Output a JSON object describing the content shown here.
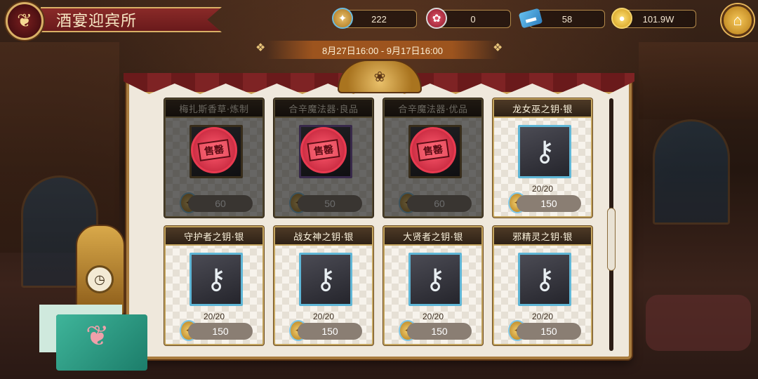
{
  "header": {
    "title": "酒宴迎宾所",
    "emblem_icon": "swirl-emblem-icon",
    "home_icon": "home-icon"
  },
  "currencies": [
    {
      "name": "medal",
      "icon": "medal-icon",
      "value": "222"
    },
    {
      "name": "rose",
      "icon": "rose-icon",
      "value": "0"
    },
    {
      "name": "ticket",
      "icon": "ticket-icon",
      "value": "58"
    },
    {
      "name": "gold",
      "icon": "gold-coin-icon",
      "value": "101.9W"
    }
  ],
  "event": {
    "date_range": "8月27日16:00 - 9月17日16:00"
  },
  "shop_items": [
    {
      "title": "梅扎斯香草·炼制",
      "price": "60",
      "count": "",
      "sold_out": true,
      "stamp_label": "售罄",
      "icon": "sold-out-stamp-icon",
      "frame": "gold"
    },
    {
      "title": "合辛魔法器·良品",
      "price": "50",
      "count": "",
      "sold_out": true,
      "stamp_label": "售罄",
      "icon": "sold-out-stamp-icon",
      "frame": "purple"
    },
    {
      "title": "合辛魔法器·优品",
      "price": "60",
      "count": "",
      "sold_out": true,
      "stamp_label": "售罄",
      "icon": "sold-out-stamp-icon",
      "frame": "gold"
    },
    {
      "title": "龙女巫之钥·银",
      "price": "150",
      "count": "20/20",
      "sold_out": false,
      "icon": "silver-key-icon",
      "frame": "blue"
    },
    {
      "title": "守护者之钥·银",
      "price": "150",
      "count": "20/20",
      "sold_out": false,
      "icon": "silver-key-icon",
      "frame": "blue"
    },
    {
      "title": "战女神之钥·银",
      "price": "150",
      "count": "20/20",
      "sold_out": false,
      "icon": "silver-key-icon",
      "frame": "blue"
    },
    {
      "title": "大贤者之钥·银",
      "price": "150",
      "count": "20/20",
      "sold_out": false,
      "icon": "silver-key-icon",
      "frame": "blue"
    },
    {
      "title": "邪精灵之钥·银",
      "price": "150",
      "count": "20/20",
      "sold_out": false,
      "icon": "silver-key-icon",
      "frame": "blue"
    }
  ],
  "colors": {
    "banner_red": "#7a1f1f",
    "gold_trim": "#c3a45e",
    "panel_bg": "#efe8dc",
    "price_pill": "#8a7e73",
    "stamp_red": "#e83a50",
    "key_frame_blue": "#5fb6d6"
  }
}
